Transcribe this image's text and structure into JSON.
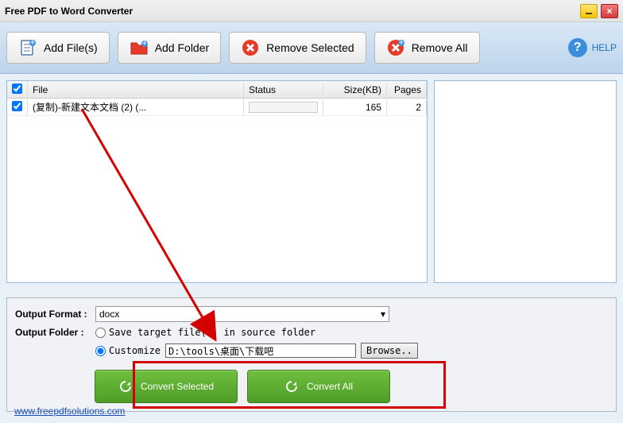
{
  "window": {
    "title": "Free PDF to Word Converter"
  },
  "toolbar": {
    "add_files": "Add File(s)",
    "add_folder": "Add Folder",
    "remove_selected": "Remove Selected",
    "remove_all": "Remove All",
    "help": "HELP"
  },
  "table": {
    "headers": {
      "file": "File",
      "status": "Status",
      "size": "Size(KB)",
      "pages": "Pages"
    },
    "rows": [
      {
        "checked": true,
        "file": "(复制)-新建文本文档 (2) (...",
        "size": "165",
        "pages": "2"
      }
    ]
  },
  "output": {
    "format_label": "Output Format :",
    "format_value": "docx",
    "folder_label": "Output Folder :",
    "save_in_source": "Save target file(s) in source folder",
    "customize": "Customize",
    "path": "D:\\tools\\桌面\\下载吧",
    "browse": "Browse.."
  },
  "convert": {
    "selected": "Convert Selected",
    "all": "Convert All"
  },
  "footer": {
    "link": "www.freepdfsolutions.com"
  }
}
